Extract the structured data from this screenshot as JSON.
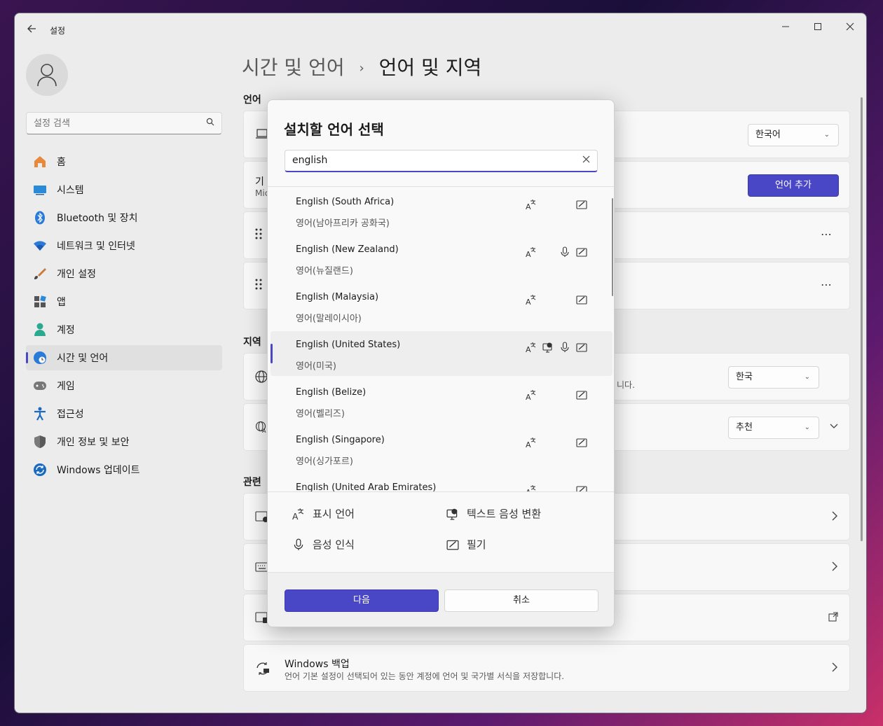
{
  "window": {
    "title": "설정",
    "back_icon": "back-arrow-icon",
    "min_icon": "minimize-icon",
    "max_icon": "maximize-icon",
    "close_icon": "close-icon"
  },
  "sidebar": {
    "search_placeholder": "설정 검색",
    "items": [
      {
        "label": "홈",
        "icon": "home-icon",
        "selected": false
      },
      {
        "label": "시스템",
        "icon": "system-icon",
        "selected": false
      },
      {
        "label": "Bluetooth 및 장치",
        "icon": "bluetooth-icon",
        "selected": false
      },
      {
        "label": "네트워크 및 인터넷",
        "icon": "network-icon",
        "selected": false
      },
      {
        "label": "개인 설정",
        "icon": "personalization-icon",
        "selected": false
      },
      {
        "label": "앱",
        "icon": "apps-icon",
        "selected": false
      },
      {
        "label": "계정",
        "icon": "accounts-icon",
        "selected": false
      },
      {
        "label": "시간 및 언어",
        "icon": "time-language-icon",
        "selected": true
      },
      {
        "label": "게임",
        "icon": "gaming-icon",
        "selected": false
      },
      {
        "label": "접근성",
        "icon": "accessibility-icon",
        "selected": false
      },
      {
        "label": "개인 정보 및 보안",
        "icon": "privacy-icon",
        "selected": false
      },
      {
        "label": "Windows 업데이트",
        "icon": "update-icon",
        "selected": false
      }
    ]
  },
  "breadcrumb": {
    "parent": "시간 및 언어",
    "separator": "›",
    "current": "언어 및 지역"
  },
  "main": {
    "language_section": "언어",
    "display_language_value": "한국어",
    "pref_languages_title_partial": "기",
    "pref_languages_desc_partial": "Mic",
    "add_language_button": "언어 추가",
    "region_section": "지역",
    "region_desc_partial": "니다.",
    "country_value": "한국",
    "regional_format_value": "추천",
    "related_section_partial": "관련",
    "backup_title": "Windows 백업",
    "backup_desc": "언어 기본 설정이 선택되어 있는 동안 계정에 언어 및 국가별 서식을 저장합니다."
  },
  "dialog": {
    "title": "설치할 언어 선택",
    "search_value": "english",
    "languages": [
      {
        "en": "English (South Africa)",
        "ko": "영어(남아프리카 공화국)",
        "display": true,
        "tts": false,
        "speech": false,
        "handwriting": true,
        "selected": false
      },
      {
        "en": "English (New Zealand)",
        "ko": "영어(뉴질랜드)",
        "display": true,
        "tts": false,
        "speech": true,
        "handwriting": true,
        "selected": false
      },
      {
        "en": "English (Malaysia)",
        "ko": "영어(말레이시아)",
        "display": true,
        "tts": false,
        "speech": false,
        "handwriting": true,
        "selected": false
      },
      {
        "en": "English (United States)",
        "ko": "영어(미국)",
        "display": true,
        "tts": true,
        "speech": true,
        "handwriting": true,
        "selected": true
      },
      {
        "en": "English (Belize)",
        "ko": "영어(벨리즈)",
        "display": true,
        "tts": false,
        "speech": false,
        "handwriting": true,
        "selected": false
      },
      {
        "en": "English (Singapore)",
        "ko": "영어(싱가포르)",
        "display": true,
        "tts": false,
        "speech": false,
        "handwriting": true,
        "selected": false
      },
      {
        "en": "English (United Arab Emirates)",
        "ko": "",
        "display": true,
        "tts": false,
        "speech": false,
        "handwriting": true,
        "selected": false
      }
    ],
    "legend": {
      "display_language": "표시 언어",
      "tts": "텍스트 음성 변환",
      "speech": "음성 인식",
      "handwriting": "필기"
    },
    "next_button": "다음",
    "cancel_button": "취소"
  },
  "colors": {
    "accent": "#4a47c6"
  }
}
